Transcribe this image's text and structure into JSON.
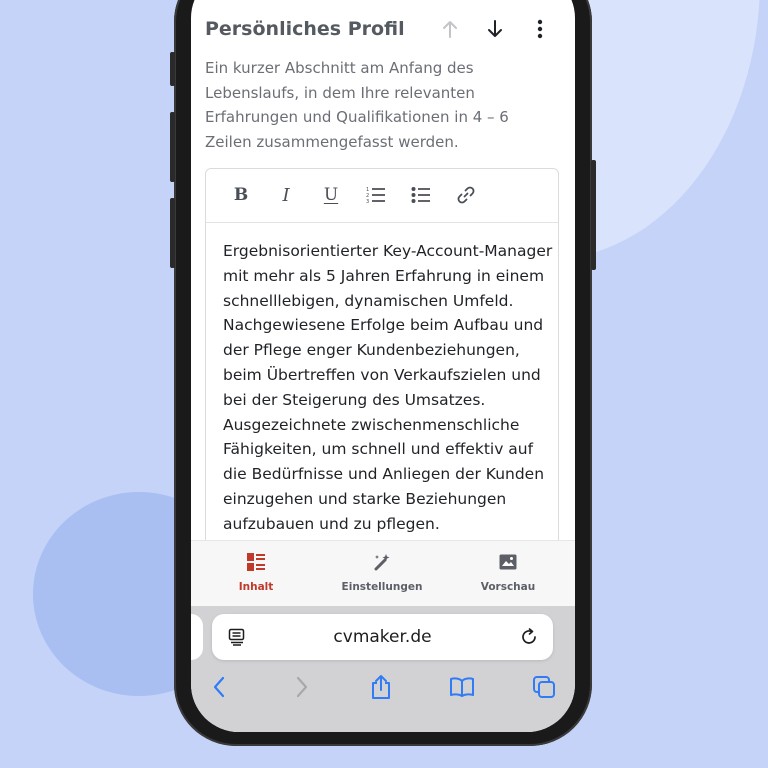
{
  "section": {
    "title": "Persönliches Profil",
    "description": "Ein kurzer Abschnitt am Anfang des Lebenslaufs, in dem Ihre relevanten Erfahrungen und Qualifikationen in 4 – 6 Zeilen zusammengefasst werden."
  },
  "editor": {
    "toolbar": {
      "bold": "B",
      "italic": "I",
      "underline": "U",
      "icons": [
        "bold-icon",
        "italic-icon",
        "underline-icon",
        "ordered-list-icon",
        "bullet-list-icon",
        "link-icon"
      ]
    },
    "content": "Ergebnisorientierter Key-Account-Manager mit mehr als 5 Jahren Erfahrung in einem schnelllebigen, dynamischen Umfeld. Nachgewiesene Erfolge beim Aufbau und der Pflege enger Kundenbeziehungen, beim Übertreffen von Verkaufszielen und bei der Steigerung des Umsatzes. Ausgezeichnete zwischenmenschliche Fähigkeiten, um schnell und effektiv auf die Bedürfnisse und Anliegen der Kunden einzugehen und starke Beziehungen aufzubauen und zu pflegen."
  },
  "bottom_nav": {
    "items": [
      {
        "label": "Inhalt",
        "icon": "content-icon",
        "active": true
      },
      {
        "label": "Einstellungen",
        "icon": "settings-wand-icon",
        "active": false
      },
      {
        "label": "Vorschau",
        "icon": "image-preview-icon",
        "active": false
      }
    ]
  },
  "browser": {
    "url": "cvmaker.de",
    "icons": [
      "reader-icon",
      "reload-icon",
      "back-icon",
      "forward-icon",
      "share-icon",
      "bookmarks-icon",
      "tabs-icon"
    ]
  },
  "colors": {
    "accent": "#c0392b",
    "safari_blue": "#2f7cf6",
    "background": "#c4d3f7"
  }
}
